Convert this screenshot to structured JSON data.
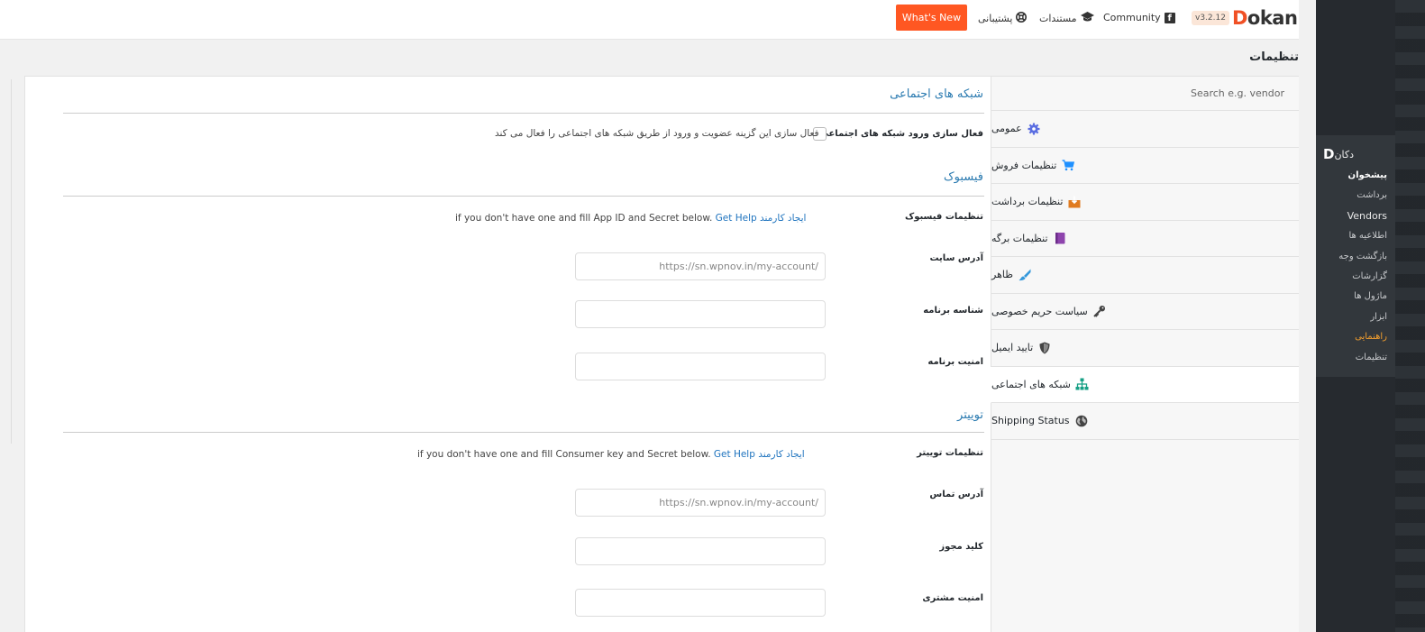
{
  "header": {
    "version": "v3.2.12",
    "logo_d": "D",
    "logo_rest": "okan",
    "community": "Community",
    "docs": "مستندات",
    "support": "پشتیبانی",
    "whats_new": "What's New"
  },
  "page": {
    "title": "تنظیمات"
  },
  "tabs": {
    "search_placeholder": "Search e.g. vendor",
    "items": [
      {
        "label": "عمومی",
        "icon": "gear-icon",
        "color": "#6a5acd"
      },
      {
        "label": "تنظیمات فروش",
        "icon": "cart-icon",
        "color": "#1e90ff"
      },
      {
        "label": "تنظیمات برداشت",
        "icon": "withdraw-icon",
        "color": "#e07b20"
      },
      {
        "label": "تنظیمات برگه",
        "icon": "page-icon",
        "color": "#8e44ad"
      },
      {
        "label": "ظاهر",
        "icon": "brush-icon",
        "color": "#3498db"
      },
      {
        "label": "سیاست حریم خصوصی",
        "icon": "key-icon",
        "color": "#444444"
      },
      {
        "label": "تایید ایمیل",
        "icon": "shield-icon",
        "color": "#444444"
      },
      {
        "label": "شبکه های اجتماعی",
        "icon": "sitemap-icon",
        "color": "#16a085"
      },
      {
        "label": "Shipping Status",
        "icon": "globe-icon",
        "color": "#444444"
      }
    ]
  },
  "social": {
    "title": "شبکه های اجتماعی",
    "enable_label": "فعال سازی ورود شبکه های اجتماعی",
    "enable_desc": "فعال سازی این گزینه عضویت و ورود از طریق شبکه های اجتماعی را فعال می کند"
  },
  "facebook": {
    "title": "فیسبوک",
    "settings_label": "تنظیمات فیسبوک",
    "settings_desc_link1": "ایجاد کارمند",
    "settings_desc_link2": "Get Help",
    "settings_desc_text": "if you don't have one and fill App ID and Secret below.",
    "site_url_label": "آدرس سایت",
    "site_url_value": "https://sn.wpnov.in/my-account/",
    "app_id_label": "شناسه برنامه",
    "app_secret_label": "امنیت برنامه"
  },
  "twitter": {
    "title": "توییتر",
    "settings_label": "تنظیمات توییتر",
    "settings_desc_link1": "ایجاد کارمند",
    "settings_desc_link2": "Get Help",
    "settings_desc_text": "if you don't have one and fill Consumer key and Secret below.",
    "callback_label": "آدرس تماس",
    "callback_value": "https://sn.wpnov.in/my-account/",
    "consumer_key_label": "کلید مجوز",
    "consumer_secret_label": "امنیت مشتری"
  },
  "wp_menu": {
    "head_glyph": "D",
    "head": "دکان",
    "items": [
      "پیشخوان",
      "برداشت",
      "Vendors",
      "اطلاعیه ها",
      "بازگشت وجه",
      "گزارشات",
      "ماژول ها",
      "ابزار",
      "راهنمایی",
      "تنظیمات"
    ]
  }
}
